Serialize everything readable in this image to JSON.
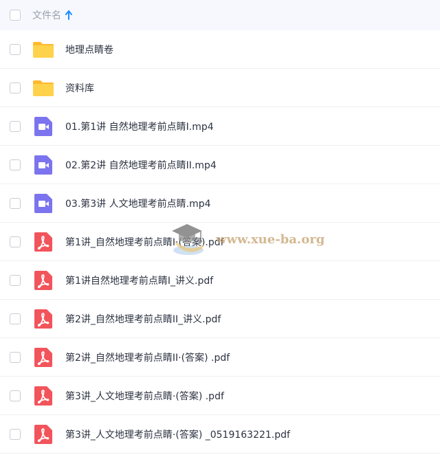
{
  "header": {
    "column_label": "文件名",
    "sort": "ascending",
    "sort_icon": "arrow-up-icon",
    "accent_color": "#1a8cff"
  },
  "files": [
    {
      "name": "地理点睛卷",
      "type": "folder",
      "icon": "folder-icon"
    },
    {
      "name": "资料库",
      "type": "folder",
      "icon": "folder-icon"
    },
    {
      "name": "01.第1讲 自然地理考前点睛I.mp4",
      "type": "video",
      "icon": "video-icon"
    },
    {
      "name": "02.第2讲 自然地理考前点睛II.mp4",
      "type": "video",
      "icon": "video-icon"
    },
    {
      "name": "03.第3讲 人文地理考前点睛.mp4",
      "type": "video",
      "icon": "video-icon"
    },
    {
      "name": "第1讲_自然地理考前点睛I·(答案).pdf",
      "type": "pdf",
      "icon": "pdf-icon"
    },
    {
      "name": "第1讲自然地理考前点睛I_讲义.pdf",
      "type": "pdf",
      "icon": "pdf-icon"
    },
    {
      "name": "第2讲_自然地理考前点睛II_讲义.pdf",
      "type": "pdf",
      "icon": "pdf-icon"
    },
    {
      "name": "第2讲_自然地理考前点睛II·(答案) .pdf",
      "type": "pdf",
      "icon": "pdf-icon"
    },
    {
      "name": "第3讲_人文地理考前点睛·(答案) .pdf",
      "type": "pdf",
      "icon": "pdf-icon"
    },
    {
      "name": "第3讲_人文地理考前点睛·(答案) _0519163221.pdf",
      "type": "pdf",
      "icon": "pdf-icon"
    }
  ],
  "watermark": {
    "text": "www.xue-ba.org",
    "icon": "graduation-cap-icon"
  },
  "colors": {
    "folder": "#ffc93d",
    "video": "#7b74ee",
    "pdf": "#f2545b",
    "header_bg": "#f6f8fd"
  }
}
